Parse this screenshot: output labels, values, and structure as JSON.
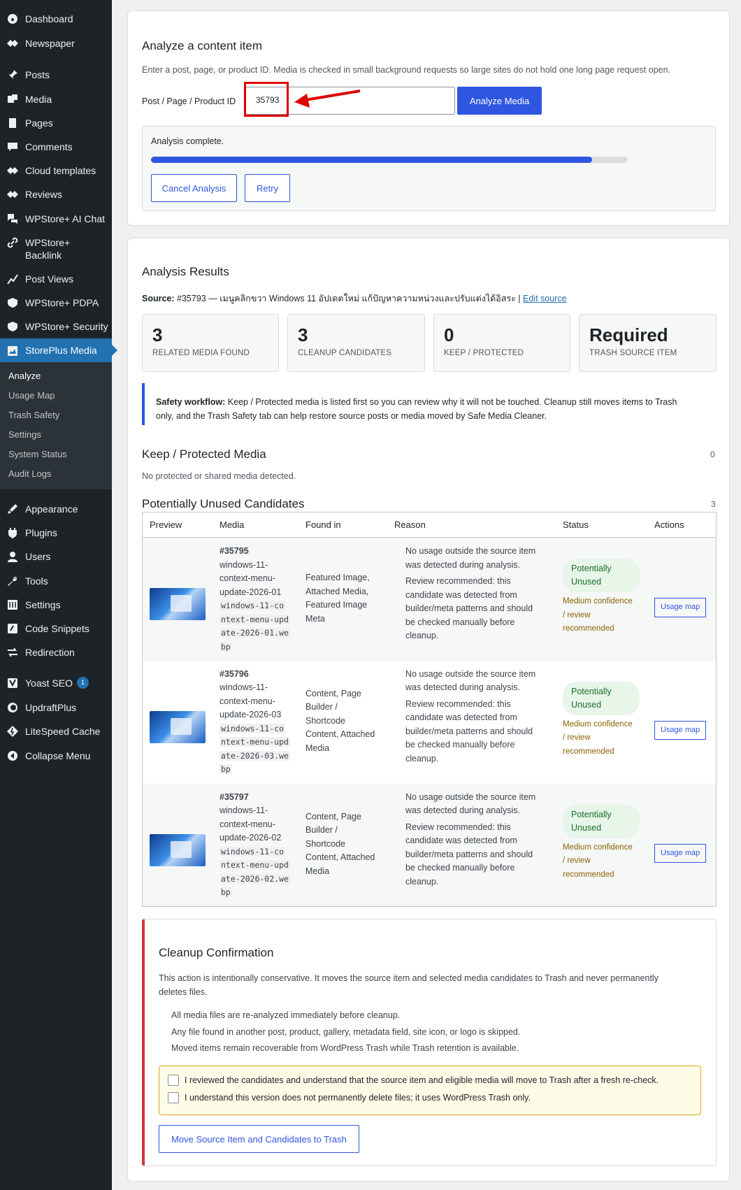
{
  "sidebar": {
    "items": [
      {
        "label": "Dashboard",
        "icon": "dashboard-icon"
      },
      {
        "label": "Newspaper",
        "icon": "newspaper-icon"
      },
      {
        "label": "Posts",
        "icon": "pin-icon"
      },
      {
        "label": "Media",
        "icon": "media-icon"
      },
      {
        "label": "Pages",
        "icon": "pages-icon"
      },
      {
        "label": "Comments",
        "icon": "comments-icon"
      },
      {
        "label": "Cloud templates",
        "icon": "cloud-templates-icon"
      },
      {
        "label": "Reviews",
        "icon": "reviews-icon"
      },
      {
        "label": "WPStore+ AI Chat",
        "icon": "chat-icon"
      },
      {
        "label": "WPStore+ Backlink",
        "icon": "link-icon"
      },
      {
        "label": "Post Views",
        "icon": "chart-icon"
      },
      {
        "label": "WPStore+ PDPA",
        "icon": "lock-icon"
      },
      {
        "label": "WPStore+ Security",
        "icon": "shield-icon"
      },
      {
        "label": "StorePlus Media",
        "icon": "storeplus-media-icon"
      },
      {
        "label": "Appearance",
        "icon": "appearance-icon"
      },
      {
        "label": "Plugins",
        "icon": "plugins-icon"
      },
      {
        "label": "Users",
        "icon": "users-icon"
      },
      {
        "label": "Tools",
        "icon": "tools-icon"
      },
      {
        "label": "Settings",
        "icon": "settings-icon"
      },
      {
        "label": "Code Snippets",
        "icon": "code-snippets-icon"
      },
      {
        "label": "Redirection",
        "icon": "redirection-icon"
      },
      {
        "label": "Yoast SEO",
        "icon": "yoast-icon",
        "badge": "1"
      },
      {
        "label": "UpdraftPlus",
        "icon": "updraft-icon"
      },
      {
        "label": "LiteSpeed Cache",
        "icon": "litespeed-icon"
      },
      {
        "label": "Collapse Menu",
        "icon": "collapse-icon"
      }
    ],
    "submenu": [
      "Analyze",
      "Usage Map",
      "Trash Safety",
      "Settings",
      "System Status",
      "Audit Logs"
    ]
  },
  "analyze": {
    "title": "Analyze a content item",
    "description": "Enter a post, page, or product ID. Media is checked in small background requests so large sites do not hold one long page request open.",
    "id_label": "Post / Page / Product ID",
    "id_value": "35793",
    "analyze_button": "Analyze Media",
    "progress_status": "Analysis complete.",
    "progress_fraction": 1.0,
    "cancel_button": "Cancel Analysis",
    "retry_button": "Retry"
  },
  "results": {
    "title": "Analysis Results",
    "source_label": "Source:",
    "source_text": "#35793 — เมนูคลิกขวา Windows 11 อัปเดตใหม่ แก้ปัญหาความหน่วงและปรับแต่งได้อิสระ |",
    "edit_source": "Edit source",
    "stats": [
      {
        "value": "3",
        "label": "RELATED MEDIA FOUND"
      },
      {
        "value": "3",
        "label": "CLEANUP CANDIDATES"
      },
      {
        "value": "0",
        "label": "KEEP / PROTECTED"
      },
      {
        "value": "Required",
        "label": "TRASH SOURCE ITEM"
      }
    ],
    "notice_bold": "Safety workflow:",
    "notice_line1": "Keep / Protected media is listed first so you can review why it will not be touched. Cleanup still moves items to Trash",
    "notice_line2": "only, and the Trash Safety tab can help restore source posts or media moved by Safe Media Cleaner.",
    "keep_title": "Keep / Protected Media",
    "keep_count": "0",
    "keep_empty": "No protected or shared media detected.",
    "candidates_title": "Potentially Unused Candidates",
    "candidates_count": "3",
    "columns": [
      "Preview",
      "Media",
      "Found in",
      "Reason",
      "Status",
      "Actions"
    ],
    "rows": [
      {
        "id": "#35795",
        "name": [
          "windows-11-",
          "context-menu-",
          "update-2026-01"
        ],
        "file": [
          "windows-11-co",
          "ntext-menu-upd",
          "ate-2026-01.we",
          "bp"
        ],
        "found": [
          "Featured Image,",
          "Attached Media,",
          "Featured Image",
          "Meta"
        ],
        "reason1": [
          "No usage outside the source item",
          "was detected during analysis."
        ],
        "reason2": [
          "Review recommended: this",
          "candidate was detected from",
          "builder/meta patterns and should",
          "be checked manually before",
          "cleanup."
        ],
        "status": [
          "Potentially",
          "Unused"
        ],
        "confidence": [
          "Medium confidence",
          "/ review",
          "recommended"
        ],
        "action": "Usage map"
      },
      {
        "id": "#35796",
        "name": [
          "windows-11-",
          "context-menu-",
          "update-2026-03"
        ],
        "file": [
          "windows-11-co",
          "ntext-menu-upd",
          "ate-2026-03.we",
          "bp"
        ],
        "found": [
          "Content, Page",
          "Builder /",
          "Shortcode",
          "Content, Attached",
          "Media"
        ],
        "reason1": [
          "No usage outside the source item",
          "was detected during analysis."
        ],
        "reason2": [
          "Review recommended: this",
          "candidate was detected from",
          "builder/meta patterns and should",
          "be checked manually before",
          "cleanup."
        ],
        "status": [
          "Potentially",
          "Unused"
        ],
        "confidence": [
          "Medium confidence",
          "/ review",
          "recommended"
        ],
        "action": "Usage map"
      },
      {
        "id": "#35797",
        "name": [
          "windows-11-",
          "context-menu-",
          "update-2026-02"
        ],
        "file": [
          "windows-11-co",
          "ntext-menu-upd",
          "ate-2026-02.we",
          "bp"
        ],
        "found": [
          "Content, Page",
          "Builder /",
          "Shortcode",
          "Content, Attached",
          "Media"
        ],
        "reason1": [
          "No usage outside the source item",
          "was detected during analysis."
        ],
        "reason2": [
          "Review recommended: this",
          "candidate was detected from",
          "builder/meta patterns and should",
          "be checked manually before",
          "cleanup."
        ],
        "status": [
          "Potentially",
          "Unused"
        ],
        "confidence": [
          "Medium confidence",
          "/ review",
          "recommended"
        ],
        "action": "Usage map"
      }
    ]
  },
  "cleanup": {
    "title": "Cleanup Confirmation",
    "intro1": "This action is intentionally conservative. It moves the source item and selected media candidates to Trash and never permanently",
    "intro2": "deletes files.",
    "bullets": [
      "All media files are re-analyzed immediately before cleanup.",
      "Any file found in another post, product, gallery, metadata field, site icon, or logo is skipped.",
      "Moved items remain recoverable from WordPress Trash while Trash retention is available."
    ],
    "check1": "I reviewed the candidates and understand that the source item and eligible media will move to Trash after a fresh re-check.",
    "check2": "I understand this version does not permanently delete files; it uses WordPress Trash only.",
    "button": "Move Source Item and Candidates to Trash"
  },
  "colors": {
    "accent": "#2f56e0",
    "danger": "#d63638",
    "sidebar": "#1d2327",
    "warning_bg": "#fefbe7"
  }
}
